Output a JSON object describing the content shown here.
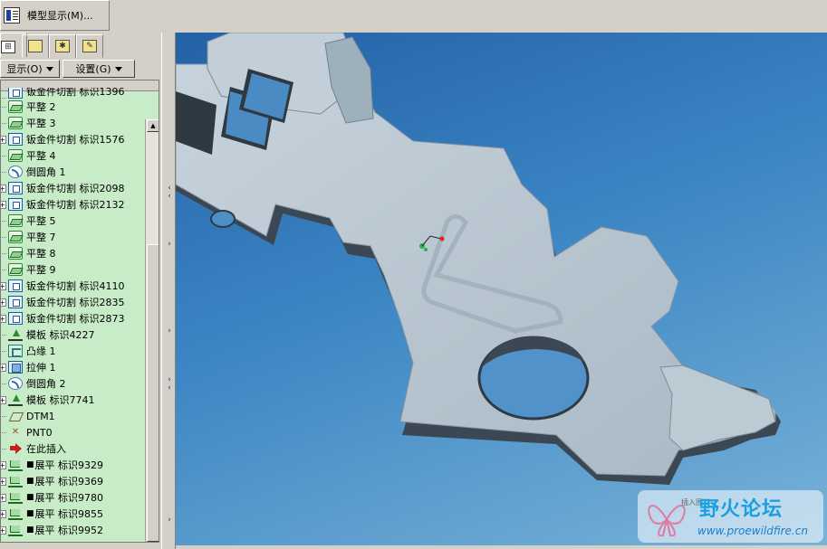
{
  "menu": {
    "model_display_label": "模型显示(M)..."
  },
  "panel": {
    "show_button": "显示(O)",
    "settings_button": "设置(G)"
  },
  "tree": {
    "partial_top_label": "钣金件切割 标识1396",
    "items": [
      {
        "icon": "flat-icon",
        "has_expander": false,
        "prefix": "",
        "label": "平整 2"
      },
      {
        "icon": "flat-icon",
        "has_expander": false,
        "prefix": "",
        "label": "平整 3"
      },
      {
        "icon": "cut-icon",
        "has_expander": true,
        "prefix": "",
        "label": "钣金件切割 标识1576"
      },
      {
        "icon": "flat-icon",
        "has_expander": false,
        "prefix": "",
        "label": "平整 4"
      },
      {
        "icon": "round-icon",
        "has_expander": false,
        "prefix": "",
        "label": "倒圆角 1"
      },
      {
        "icon": "cut-icon",
        "has_expander": true,
        "prefix": "",
        "label": "钣金件切割 标识2098"
      },
      {
        "icon": "cut-icon",
        "has_expander": true,
        "prefix": "",
        "label": "钣金件切割 标识2132"
      },
      {
        "icon": "flat-icon",
        "has_expander": false,
        "prefix": "",
        "label": "平整 5"
      },
      {
        "icon": "flat-icon",
        "has_expander": false,
        "prefix": "",
        "label": "平整 7"
      },
      {
        "icon": "flat-icon",
        "has_expander": false,
        "prefix": "",
        "label": "平整 8"
      },
      {
        "icon": "flat-icon",
        "has_expander": false,
        "prefix": "",
        "label": "平整 9"
      },
      {
        "icon": "cut-icon",
        "has_expander": true,
        "prefix": "",
        "label": "钣金件切割 标识4110"
      },
      {
        "icon": "cut-icon",
        "has_expander": true,
        "prefix": "",
        "label": "钣金件切割 标识2835"
      },
      {
        "icon": "cut-icon",
        "has_expander": true,
        "prefix": "",
        "label": "钣金件切割 标识2873"
      },
      {
        "icon": "form-icon",
        "has_expander": false,
        "prefix": "",
        "label": "模板 标识4227"
      },
      {
        "icon": "flange-icon",
        "has_expander": false,
        "prefix": "",
        "label": "凸缘 1"
      },
      {
        "icon": "extrude-icon",
        "has_expander": true,
        "prefix": "",
        "label": "拉伸 1"
      },
      {
        "icon": "round-icon",
        "has_expander": false,
        "prefix": "",
        "label": "倒圆角 2"
      },
      {
        "icon": "form-icon",
        "has_expander": true,
        "prefix": "",
        "label": "模板 标识7741"
      },
      {
        "icon": "datum-plane-icon",
        "has_expander": false,
        "prefix": "",
        "label": "DTM1"
      },
      {
        "icon": "datum-point-icon",
        "has_expander": false,
        "prefix": "",
        "label": "PNT0"
      },
      {
        "icon": "insert-here-icon",
        "has_expander": false,
        "prefix": "",
        "label": "在此插入"
      },
      {
        "icon": "unfold-icon",
        "has_expander": true,
        "prefix": "■",
        "label": "展平 标识9329"
      },
      {
        "icon": "unfold-icon",
        "has_expander": true,
        "prefix": "■",
        "label": "展平 标识9369"
      },
      {
        "icon": "unfold-icon",
        "has_expander": true,
        "prefix": "■",
        "label": "展平 标识9780"
      },
      {
        "icon": "unfold-icon",
        "has_expander": true,
        "prefix": "■",
        "label": "展平 标识9855"
      },
      {
        "icon": "unfold-icon",
        "has_expander": true,
        "prefix": "■",
        "label": "展平 标识9952"
      }
    ]
  },
  "watermark": {
    "title": "野火论坛",
    "url": "www.proewildfire.cn",
    "small_text": "插入图"
  },
  "colors": {
    "tree_bg": "#c8ebc8",
    "viewport_top": "#2361a7",
    "viewport_bottom": "#79b3d8",
    "part_face": "#b9c7d2",
    "part_shadow": "#3d4650"
  }
}
